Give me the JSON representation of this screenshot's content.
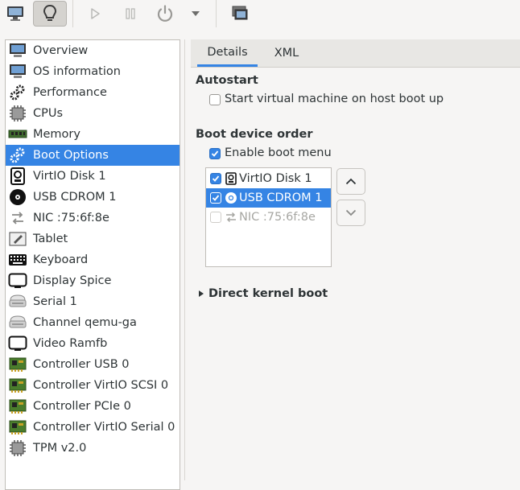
{
  "toolbar": {
    "buttons": [
      {
        "name": "console",
        "icon": "monitor-icon"
      },
      {
        "name": "details",
        "icon": "lightbulb-icon",
        "active": true
      },
      {
        "name": "run",
        "icon": "play-icon"
      },
      {
        "name": "pause",
        "icon": "pause-icon"
      },
      {
        "name": "shutdown",
        "icon": "power-icon"
      },
      {
        "name": "shutdown-menu",
        "icon": "chevron-down-icon"
      },
      {
        "name": "snapshots",
        "icon": "snapshots-icon"
      }
    ]
  },
  "sidebar": {
    "items": [
      {
        "label": "Overview",
        "icon": "monitor-icon"
      },
      {
        "label": "OS information",
        "icon": "monitor-icon"
      },
      {
        "label": "Performance",
        "icon": "gears-icon"
      },
      {
        "label": "CPUs",
        "icon": "chip-icon"
      },
      {
        "label": "Memory",
        "icon": "memory-icon"
      },
      {
        "label": "Boot Options",
        "icon": "gears-icon",
        "selected": true
      },
      {
        "label": "VirtIO Disk 1",
        "icon": "disk-icon"
      },
      {
        "label": "USB CDROM 1",
        "icon": "cdrom-icon"
      },
      {
        "label": "NIC :75:6f:8e",
        "icon": "network-icon"
      },
      {
        "label": "Tablet",
        "icon": "tablet-icon"
      },
      {
        "label": "Keyboard",
        "icon": "keyboard-icon"
      },
      {
        "label": "Display Spice",
        "icon": "display-icon"
      },
      {
        "label": "Serial 1",
        "icon": "serial-icon"
      },
      {
        "label": "Channel qemu-ga",
        "icon": "serial-icon"
      },
      {
        "label": "Video Ramfb",
        "icon": "display-icon"
      },
      {
        "label": "Controller USB 0",
        "icon": "controller-icon"
      },
      {
        "label": "Controller VirtIO SCSI 0",
        "icon": "controller-icon"
      },
      {
        "label": "Controller PCIe 0",
        "icon": "controller-icon"
      },
      {
        "label": "Controller VirtIO Serial 0",
        "icon": "controller-icon"
      },
      {
        "label": "TPM v2.0",
        "icon": "chip-icon"
      }
    ]
  },
  "tabs": [
    {
      "label": "Details",
      "active": true
    },
    {
      "label": "XML",
      "active": false
    }
  ],
  "autostart": {
    "heading": "Autostart",
    "checkbox_label": "Start virtual machine on host boot up",
    "checked": false
  },
  "boot": {
    "heading": "Boot device order",
    "enable_menu_label": "Enable boot menu",
    "enable_menu_checked": true,
    "devices": [
      {
        "label": "VirtIO Disk 1",
        "checked": true,
        "icon": "disk-icon"
      },
      {
        "label": "USB CDROM 1",
        "checked": true,
        "icon": "cdrom-icon",
        "selected": true
      },
      {
        "label": "NIC :75:6f:8e",
        "checked": false,
        "icon": "network-icon",
        "disabled": true
      }
    ],
    "move_up_icon": "chevron-up-icon",
    "move_down_icon": "chevron-down-icon"
  },
  "kernel": {
    "label": "Direct kernel boot",
    "expanded": false
  }
}
